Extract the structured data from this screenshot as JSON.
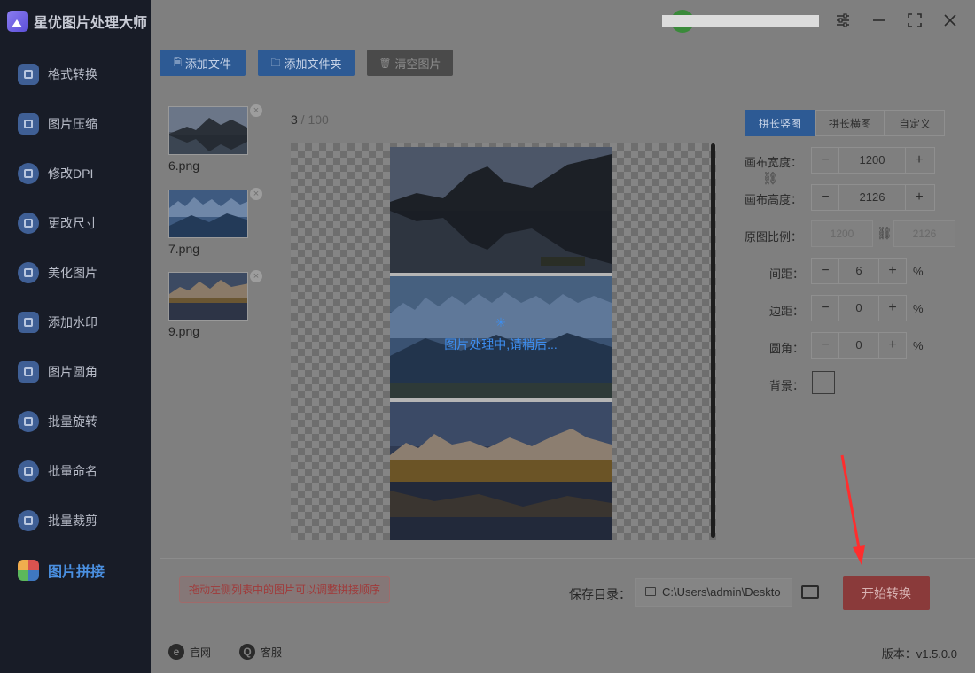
{
  "app": {
    "title": "星优图片处理大师"
  },
  "sidebar": {
    "items": [
      {
        "label": "格式转换"
      },
      {
        "label": "图片压缩"
      },
      {
        "label": "修改DPI"
      },
      {
        "label": "更改尺寸"
      },
      {
        "label": "美化图片"
      },
      {
        "label": "添加水印"
      },
      {
        "label": "图片圆角"
      },
      {
        "label": "批量旋转"
      },
      {
        "label": "批量命名"
      },
      {
        "label": "批量裁剪"
      },
      {
        "label": "图片拼接",
        "active": true
      }
    ]
  },
  "toolbar": {
    "add_file": "添加文件",
    "add_folder": "添加文件夹",
    "clear_images": "清空图片"
  },
  "file_list": [
    {
      "name": "6.png"
    },
    {
      "name": "7.png"
    },
    {
      "name": "9.png"
    }
  ],
  "counter": {
    "current": "3",
    "separator": " / ",
    "max": "100"
  },
  "preview": {
    "loading_text": "图片处理中,请稍后..."
  },
  "settings": {
    "tabs": [
      {
        "label": "拼长竖图",
        "active": true
      },
      {
        "label": "拼长横图",
        "active": false
      },
      {
        "label": "自定义",
        "active": false
      }
    ],
    "canvas_width": {
      "label": "画布宽度：",
      "value": "1200"
    },
    "canvas_height": {
      "label": "画布高度：",
      "value": "2126"
    },
    "original_ratio": {
      "label": "原图比例：",
      "width": "1200",
      "height": "2126"
    },
    "spacing": {
      "label": "间距：",
      "value": "6",
      "unit": "%"
    },
    "margin": {
      "label": "边距：",
      "value": "0",
      "unit": "%"
    },
    "corner": {
      "label": "圆角：",
      "value": "0",
      "unit": "%"
    },
    "background": {
      "label": "背景："
    },
    "minus": "−",
    "plus": "+"
  },
  "bottom": {
    "hint": "拖动左侧列表中的图片可以调整拼接顺序",
    "save_label": "保存目录：",
    "save_path": "C:\\Users\\admin\\Deskto",
    "start_button": "开始转换"
  },
  "footer": {
    "website": "官网",
    "service": "客服",
    "version": "版本：v1.5.0.0"
  },
  "colors": {
    "accent": "#2d5a94",
    "start_button": "#8a3a3a",
    "loading_text": "#3d8ef0",
    "arrow": "#ff2d2d"
  }
}
